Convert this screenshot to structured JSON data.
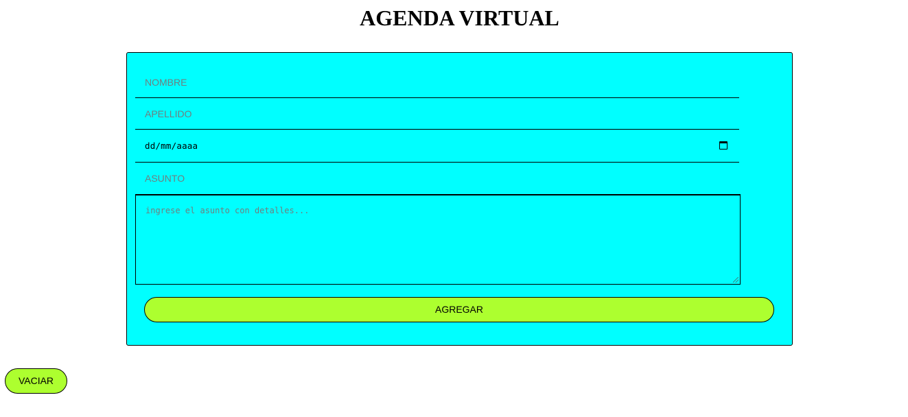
{
  "header": {
    "title": "AGENDA VIRTUAL"
  },
  "form": {
    "nombre_placeholder": "NOMBRE",
    "apellido_placeholder": "APELLIDO",
    "fecha_placeholder": "dd/mm/aaaa",
    "asunto_placeholder": "ASUNTO",
    "detalle_placeholder": "ingrese el asunto con detalles...",
    "submit_label": "AGREGAR"
  },
  "actions": {
    "clear_label": "VACIAR"
  },
  "colors": {
    "card_background": "#00ffff",
    "button_background": "#adff2f",
    "border": "#000000"
  },
  "icons": {
    "date_picker": "calendar-icon"
  }
}
